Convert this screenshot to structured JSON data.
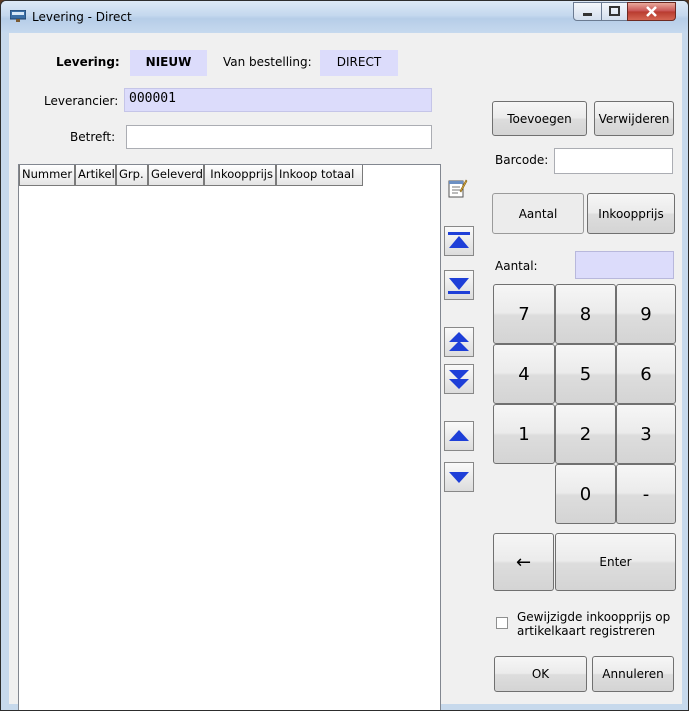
{
  "window": {
    "title": "Levering - Direct"
  },
  "header": {
    "levering_label": "Levering:",
    "levering_value": "NIEUW",
    "bestelling_label": "Van bestelling:",
    "bestelling_value": "DIRECT",
    "leverancier_label": "Leverancier:",
    "leverancier_value": "000001",
    "betreft_label": "Betreft:",
    "betreft_value": ""
  },
  "table": {
    "columns": [
      "Nummer",
      "Artikel",
      "Grp.",
      "Geleverd",
      "Inkoopprijs",
      "Inkoop totaal"
    ],
    "rows": []
  },
  "actions": {
    "add_label": "Toevoegen",
    "remove_label": "Verwijderen",
    "barcode_label": "Barcode:",
    "barcode_value": ""
  },
  "mode": {
    "aantal_label": "Aantal",
    "inkoopprijs_label": "Inkoopprijs"
  },
  "keypad": {
    "field_label": "Aantal:",
    "field_value": "",
    "keys": [
      "7",
      "8",
      "9",
      "4",
      "5",
      "6",
      "1",
      "2",
      "3",
      "0",
      "-"
    ],
    "back_symbol": "←",
    "enter_label": "Enter"
  },
  "options": {
    "register_price_label": "Gewijzigde inkoopprijs op artikelkaart registreren",
    "register_price_checked": false
  },
  "footer": {
    "ok_label": "OK",
    "cancel_label": "Annuleren"
  },
  "icons": [
    "notepad-icon",
    "first-icon",
    "last-icon",
    "page-up-icon",
    "page-down-icon",
    "up-icon",
    "down-icon"
  ],
  "colors": {
    "accent_field": "#dcdcfb",
    "nav_arrow": "#1e3fd8"
  }
}
